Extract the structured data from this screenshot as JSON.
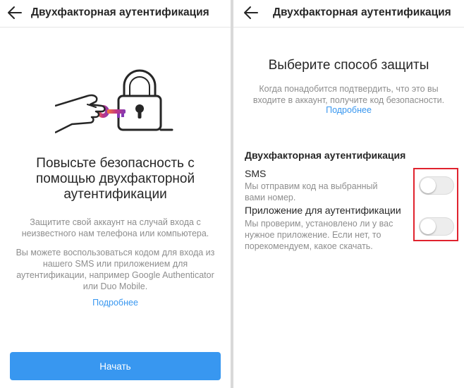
{
  "left_screen": {
    "title": "Двухфакторная аутентификация",
    "headline": "Повысьте безопасность с помощью двухфакторной аутентификации",
    "intro": "Защитите свой аккаунт на случай входа с неизвестного нам телефона или компьютера.",
    "methods": "Вы можете воспользоваться кодом для входа из нашего SMS или приложением для аутентификации, например Google Authenticator или Duo Mobile.",
    "learn_more": "Подробнее",
    "start_button": "Начать"
  },
  "right_screen": {
    "title": "Двухфакторная аутентификация",
    "choose_title": "Выберите способ защиты",
    "description": "Когда понадобится подтвердить, что это вы входите в аккаунт, получите код безопасности.",
    "learn_more": "Подробнее",
    "section_label": "Двухфакторная аутентификация",
    "options": [
      {
        "title": "SMS",
        "description": "Мы отправим код на выбранный вами номер.",
        "enabled": false
      },
      {
        "title": "Приложение для аутентификации",
        "description": "Мы проверим, установлено ли у вас нужное приложение. Если нет, то порекомендуем, какое скачать.",
        "enabled": false
      }
    ]
  },
  "colors": {
    "accent": "#3897f0",
    "highlight_frame": "#e0232e",
    "key_gradient": [
      "#f77737",
      "#c13584",
      "#833ab4"
    ]
  },
  "icons": [
    "back-arrow-icon",
    "hand-key-lock-illustration"
  ]
}
